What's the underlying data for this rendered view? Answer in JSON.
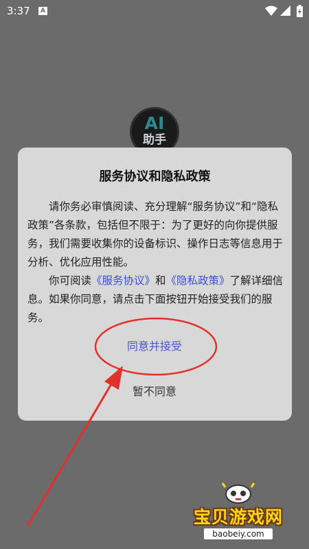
{
  "status_bar": {
    "time": "3:37",
    "notification_badge": "A",
    "icons": [
      "wifi-icon",
      "signal-icon",
      "battery-icon"
    ]
  },
  "app_icon": {
    "line1": "AI",
    "line2": "助手"
  },
  "dialog": {
    "title": "服务协议和隐私政策",
    "paragraph1": "请你务必审慎阅读、充分理解“服务协议”和“隐私政策”各条款，包括但不限于：为了更好的向你提供服务，我们需要收集你的设备标识、操作日志等信息用于分析、优化应用性能。",
    "paragraph2_prefix": "你可阅读",
    "service_agreement_link": "《服务协议》",
    "paragraph2_and": "和",
    "privacy_policy_link": "《隐私政策》",
    "paragraph2_suffix": "了解详细信息。如果你同意，请点击下面按钮开始接受我们的服务。",
    "agree_label": "同意并接受",
    "disagree_label": "暂不同意"
  },
  "watermark": {
    "brand": "宝贝游戏网",
    "url": "baobeiy.com"
  },
  "colors": {
    "background": "#6b6b6b",
    "dialog": "#d8d8d8",
    "link": "#3d4fd6",
    "annotation": "#e0322a"
  }
}
